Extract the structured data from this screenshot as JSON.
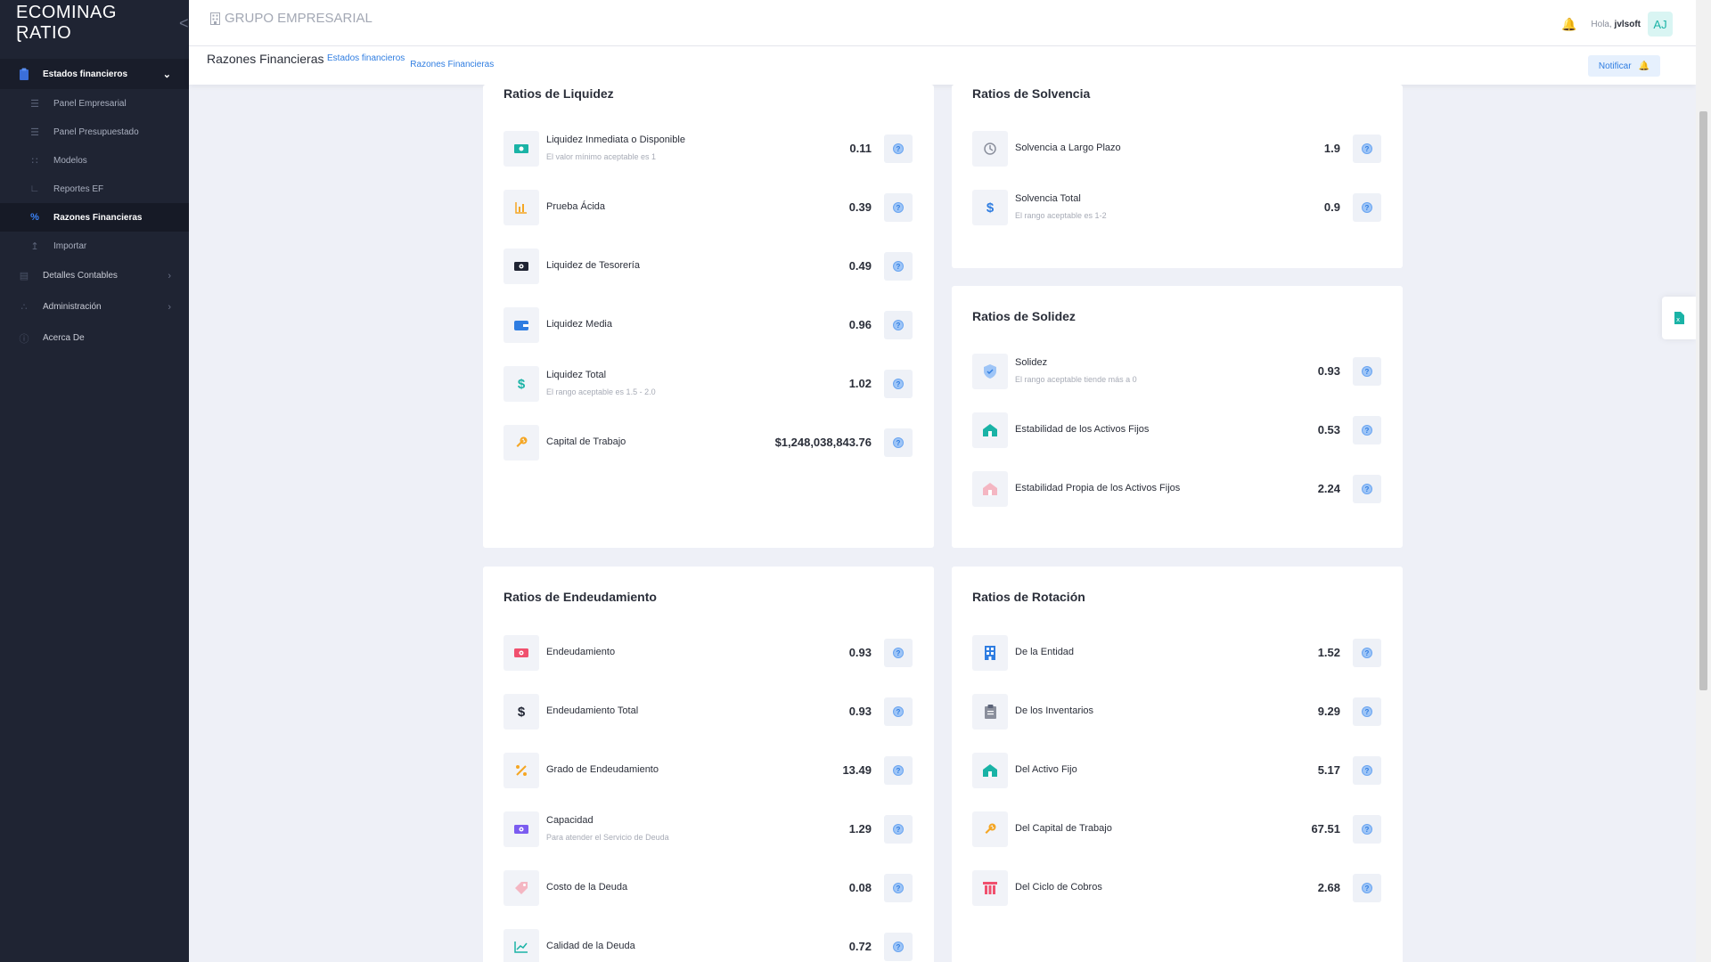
{
  "logo": {
    "text": "ECOMINAG ⱤATIO",
    "chevron": "<"
  },
  "sidebar": {
    "group": {
      "label": "Estados financieros",
      "icon": "clipboard-icon"
    },
    "subitems": [
      {
        "label": "Panel Empresarial",
        "icon": "list-icon"
      },
      {
        "label": "Panel Presupuestado",
        "icon": "list-icon"
      },
      {
        "label": "Modelos",
        "icon": "grid-icon"
      },
      {
        "label": "Reportes EF",
        "icon": "chart-icon"
      },
      {
        "label": "Razones Financieras",
        "icon": "percent-icon",
        "active": true
      },
      {
        "label": "Importar",
        "icon": "upload-icon"
      }
    ],
    "items": [
      {
        "label": "Detalles Contables",
        "icon": "columns-icon",
        "has_children": true
      },
      {
        "label": "Administración",
        "icon": "settings-icon",
        "has_children": true
      },
      {
        "label": "Acerca De",
        "icon": "info-icon",
        "has_children": false
      }
    ]
  },
  "topbar": {
    "company": "GRUPO EMPRESARIAL",
    "greeting": "Hola,",
    "username": "jvlsoft",
    "avatar_initials": "AJ"
  },
  "subbar": {
    "title": "Razones Financieras",
    "breadcrumbs": [
      "Estados financieros",
      "Razones Financieras"
    ],
    "notify_label": "Notificar"
  },
  "cards": {
    "liquidez": {
      "title": "Ratios de Liquidez",
      "rows": [
        {
          "label": "Liquidez Inmediata o Disponible",
          "hint": "El valor mínimo aceptable es 1",
          "value": "0.11",
          "icon": "cash-icon",
          "color": "#1ab3a6"
        },
        {
          "label": "Prueba Ácida",
          "hint": "",
          "value": "0.39",
          "icon": "bar-chart-icon",
          "color": "#f5a623"
        },
        {
          "label": "Liquidez de Tesorería",
          "hint": "",
          "value": "0.49",
          "icon": "money-icon",
          "color": "#1f2433"
        },
        {
          "label": "Liquidez Media",
          "hint": "",
          "value": "0.96",
          "icon": "wallet-icon",
          "color": "#2f7de1"
        },
        {
          "label": "Liquidez Total",
          "hint": "El rango aceptable es 1.5 - 2.0",
          "value": "1.02",
          "icon": "dollar-icon",
          "color": "#1ab3a6"
        },
        {
          "label": "Capital de Trabajo",
          "hint": "",
          "value": "$1,248,038,843.76",
          "icon": "wrench-icon",
          "color": "#f5a623"
        }
      ]
    },
    "solvencia": {
      "title": "Ratios de Solvencia",
      "rows": [
        {
          "label": "Solvencia a Largo Plazo",
          "hint": "",
          "value": "1.9",
          "icon": "history-icon",
          "color": "#8a8f9c"
        },
        {
          "label": "Solvencia Total",
          "hint": "El rango aceptable es 1-2",
          "value": "0.9",
          "icon": "dollar-icon",
          "color": "#2f7de1"
        }
      ]
    },
    "solidez": {
      "title": "Ratios de Solidez",
      "rows": [
        {
          "label": "Solidez",
          "hint": "El rango aceptable tiende más a 0",
          "value": "0.93",
          "icon": "shield-icon",
          "color": "#9ec5f7"
        },
        {
          "label": "Estabilidad de los Activos Fijos",
          "hint": "",
          "value": "0.53",
          "icon": "home-icon",
          "color": "#1ab3a6"
        },
        {
          "label": "Estabilidad Propia de los Activos Fijos",
          "hint": "",
          "value": "2.24",
          "icon": "home-icon",
          "color": "#f4b6c2"
        }
      ]
    },
    "endeudamiento": {
      "title": "Ratios de Endeudamiento",
      "rows": [
        {
          "label": "Endeudamiento",
          "hint": "",
          "value": "0.93",
          "icon": "money-icon",
          "color": "#f0506e"
        },
        {
          "label": "Endeudamiento Total",
          "hint": "",
          "value": "0.93",
          "icon": "dollar-icon",
          "color": "#1f2433"
        },
        {
          "label": "Grado de Endeudamiento",
          "hint": "",
          "value": "13.49",
          "icon": "percent-icon",
          "color": "#f5a623"
        },
        {
          "label": "Capacidad",
          "hint": "Para atender el Servicio de Deuda",
          "value": "1.29",
          "icon": "money-icon",
          "color": "#7b5cf0"
        },
        {
          "label": "Costo de la Deuda",
          "hint": "",
          "value": "0.08",
          "icon": "tag-icon",
          "color": "#f4b6c2"
        },
        {
          "label": "Calidad de la Deuda",
          "hint": "",
          "value": "0.72",
          "icon": "line-chart-icon",
          "color": "#1ab3a6"
        }
      ]
    },
    "rotacion": {
      "title": "Ratios de Rotación",
      "rows": [
        {
          "label": "De la Entidad",
          "hint": "",
          "value": "1.52",
          "icon": "building-icon",
          "color": "#2f7de1"
        },
        {
          "label": "De los Inventarios",
          "hint": "",
          "value": "9.29",
          "icon": "clipboard-icon",
          "color": "#8a8f9c"
        },
        {
          "label": "Del Activo Fijo",
          "hint": "",
          "value": "5.17",
          "icon": "home-icon",
          "color": "#1ab3a6"
        },
        {
          "label": "Del Capital de Trabajo",
          "hint": "",
          "value": "67.51",
          "icon": "wrench-icon",
          "color": "#f5a623"
        },
        {
          "label": "Del Ciclo de Cobros",
          "hint": "",
          "value": "2.68",
          "icon": "columns-icon",
          "color": "#f0506e"
        }
      ]
    }
  }
}
